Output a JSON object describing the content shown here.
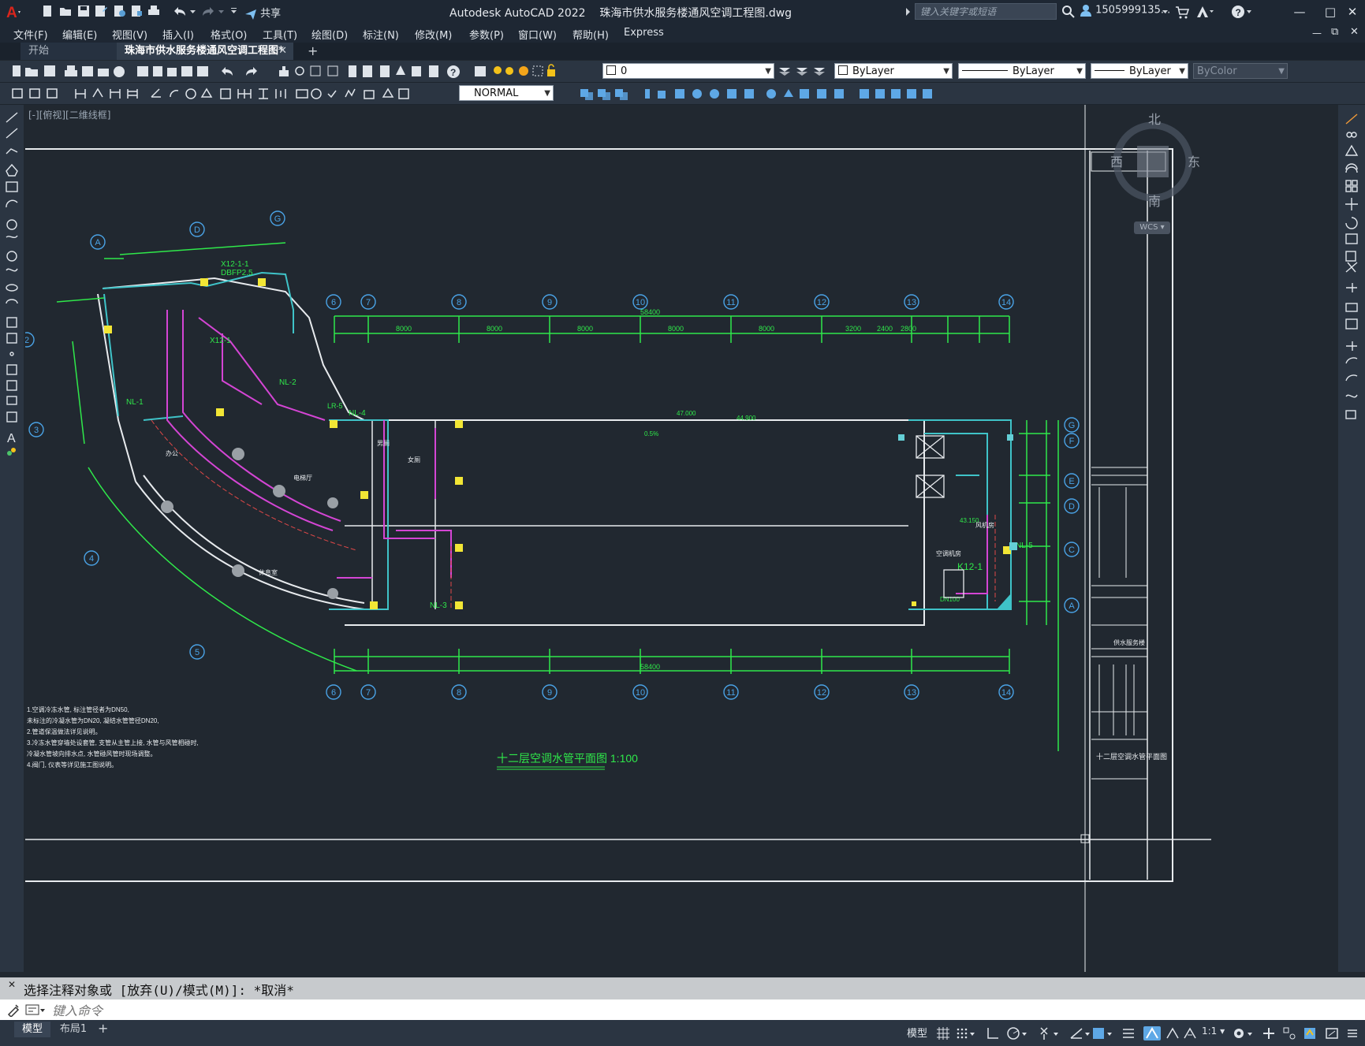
{
  "app": {
    "title": "Autodesk AutoCAD 2022",
    "filename": "珠海市供水服务楼通风空调工程图.dwg",
    "share_label": "共享",
    "search_placeholder": "键入关键字或短语",
    "user_label": "1505999135...",
    "accent_color": "#d9251c"
  },
  "menu": {
    "items": [
      "文件(F)",
      "编辑(E)",
      "视图(V)",
      "插入(I)",
      "格式(O)",
      "工具(T)",
      "绘图(D)",
      "标注(N)",
      "修改(M)",
      "参数(P)",
      "窗口(W)",
      "帮助(H)",
      "Express"
    ]
  },
  "tabs": [
    {
      "label": "开始",
      "active": false
    },
    {
      "label": "珠海市供水服务楼通风空调工程图*",
      "active": true
    }
  ],
  "toolbar": {
    "layer_value": "0",
    "color_value": "ByLayer",
    "linetype_value": "ByLayer",
    "lineweight_value": "ByLayer",
    "plotstyle_value": "ByColor",
    "dimstyle_value": "NORMAL"
  },
  "viewport": {
    "label": "[-][俯视][二维线框]"
  },
  "viewcube": {
    "north": "北",
    "south": "南",
    "east": "东",
    "west": "西",
    "wcs": "WCS"
  },
  "drawing": {
    "plan_title": "十二层空调水管平面图 1:100",
    "grid_top": [
      "6",
      "7",
      "8",
      "9",
      "10",
      "11",
      "12",
      "13",
      "14"
    ],
    "grid_right": [
      "G",
      "F",
      "E",
      "D",
      "C",
      "A"
    ],
    "grid_left_letters": [
      "A",
      "D",
      "G"
    ],
    "grid_left_numbers": [
      "2",
      "3",
      "4",
      "5"
    ],
    "overall_dim": "58400",
    "dims_top": [
      "8000",
      "8000",
      "8000",
      "8000",
      "8000",
      "3200",
      "2400",
      "2800"
    ],
    "labels": [
      "X12-1-1",
      "DBFP2.5",
      "NL-1",
      "NL-2",
      "NL-3",
      "NL-4",
      "NL-5",
      "X12-1",
      "K12-1",
      "LR-5",
      "47.000",
      "44.900",
      "0.5%",
      "DN100",
      "女厕",
      "男厕",
      "电梯厅",
      "办公",
      "休息室",
      "空调机房",
      "风机房",
      "43.150"
    ],
    "notes": [
      "1.空调冷冻水管, 标注管径者为DN50,",
      "未标注的冷凝水管为DN20, 凝结水管管径DN20,",
      "2.管道保温做法详见说明。",
      "3.冷冻水管穿墙处设套管, 支管从主管上接, 水管与风管相碰时,",
      "冷凝水管坡向排水点, 水管碰风管时现场调整。",
      "4.阀门, 仪表等详见施工图说明。"
    ],
    "titleblock_name": "供水服务楼",
    "titleblock_sheet": "十二层空调水管平面图"
  },
  "command": {
    "history": "选择注释对象或 [放弃(U)/模式(M)]: *取消*",
    "placeholder": "键入命令"
  },
  "status": {
    "model_tab": "模型",
    "layout_tab": "布局1",
    "model_label": "模型",
    "scale": "1:1"
  }
}
